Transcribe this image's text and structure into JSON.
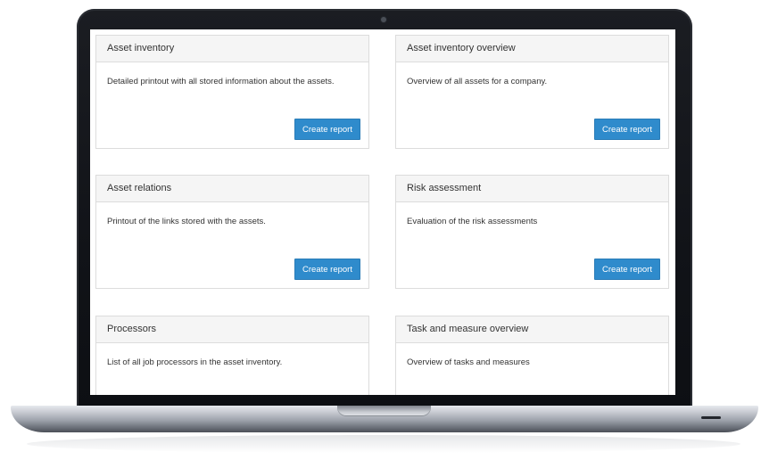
{
  "reports": [
    {
      "title": "Asset inventory",
      "description": "Detailed printout with all stored information about the assets.",
      "button_label": "Create report"
    },
    {
      "title": "Asset inventory overview",
      "description": "Overview of all assets for a company.",
      "button_label": "Create report"
    },
    {
      "title": "Asset relations",
      "description": "Printout of the links stored with the assets.",
      "button_label": "Create report"
    },
    {
      "title": "Risk assessment",
      "description": "Evaluation of the risk assessments",
      "button_label": "Create report"
    },
    {
      "title": "Processors",
      "description": "List of all job processors in the asset inventory."
    },
    {
      "title": "Task and measure overview",
      "description": "Overview of tasks and measures"
    }
  ],
  "colors": {
    "button_bg": "#2f8bcc",
    "card_header_bg": "#f5f5f5",
    "card_border": "#dcdcdc"
  }
}
